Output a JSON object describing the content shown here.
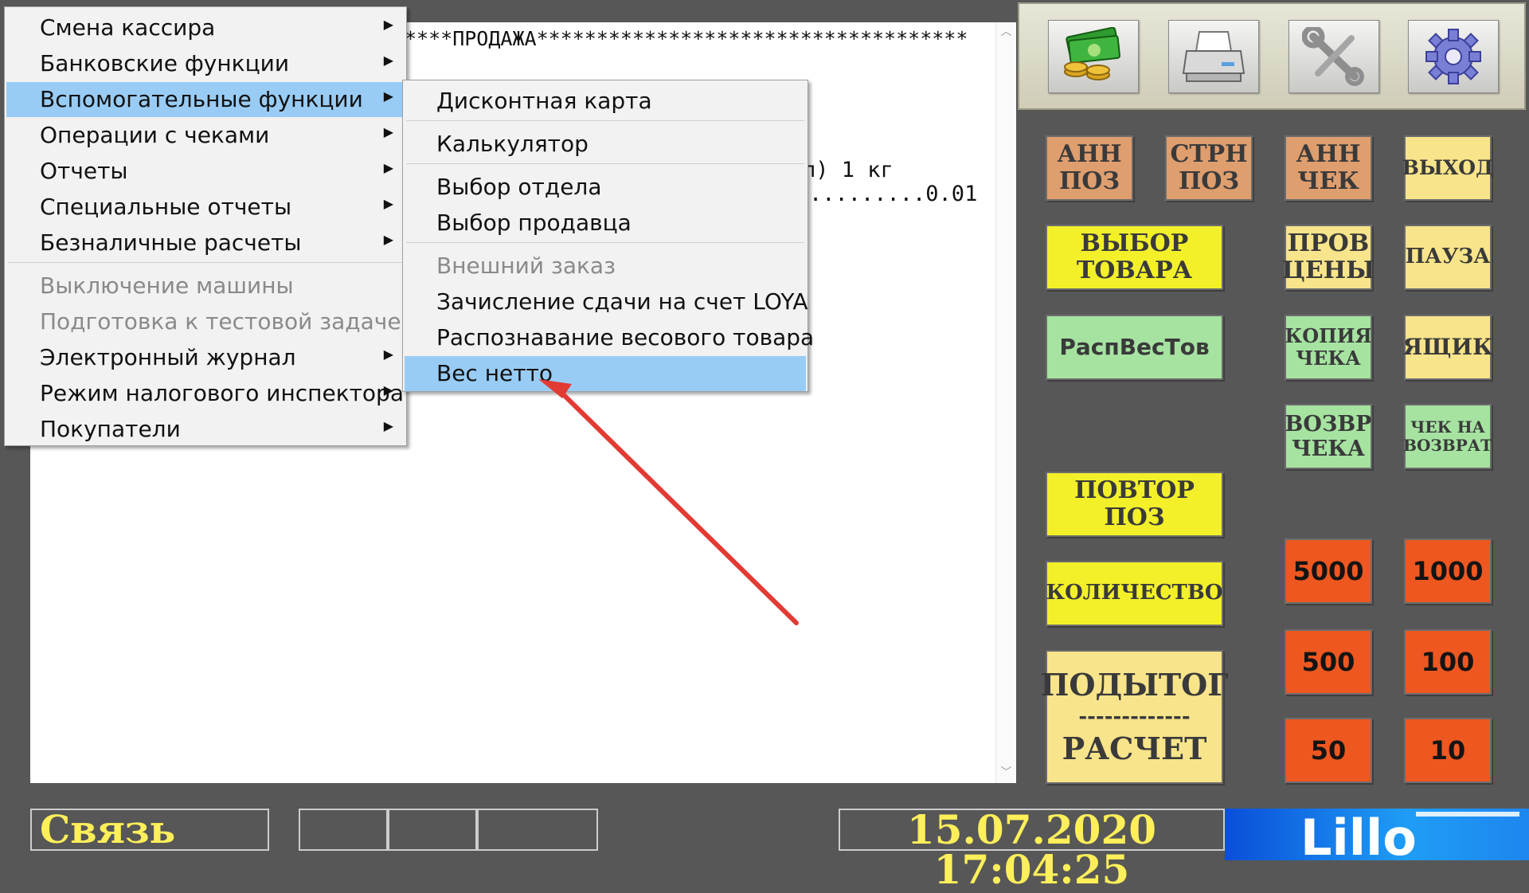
{
  "receipt": {
    "header": "****ПРОДАЖА************************************",
    "line_item": "л) 1 кг",
    "line_price": ".........0.01",
    "scroll_up_icon": "chevron-up-icon",
    "scroll_down_icon": "chevron-down-icon"
  },
  "main_menu": {
    "items": [
      {
        "label": "Смена кассира",
        "submenu": true
      },
      {
        "label": "Банковские функции",
        "submenu": true
      },
      {
        "label": "Вспомогательные функции",
        "submenu": true,
        "highlighted": true
      },
      {
        "label": "Операции с чеками",
        "submenu": true
      },
      {
        "label": "Отчеты",
        "submenu": true
      },
      {
        "label": "Специальные отчеты",
        "submenu": true
      },
      {
        "label": "Безналичные расчеты",
        "submenu": true
      },
      {
        "label": "Выключение машины",
        "disabled": true
      },
      {
        "label": "Подготовка к тестовой задаче",
        "disabled": true
      },
      {
        "label": "Электронный журнал",
        "submenu": true
      },
      {
        "label": "Режим налогового инспектора",
        "submenu": true
      },
      {
        "label": "Покупатели",
        "submenu": true
      }
    ]
  },
  "sub_menu": {
    "items": [
      {
        "label": "Дисконтная карта"
      },
      {
        "label": "Калькулятор"
      },
      {
        "label": "Выбор отдела"
      },
      {
        "label": "Выбор продавца"
      },
      {
        "label": "Внешний заказ",
        "disabled": true
      },
      {
        "label": "Зачисление сдачи на счет LOYA"
      },
      {
        "label": "Распознавание весового товара"
      },
      {
        "label": "Вес нетто",
        "highlighted": true
      }
    ]
  },
  "toolbar": {
    "icons": [
      "money-icon",
      "printer-icon",
      "wrench-icon",
      "gear-icon"
    ]
  },
  "buttons": {
    "ann_pos": "АНН\nПОЗ",
    "strn_pos": "СТРН\nПОЗ",
    "ann_chek": "АНН\nЧЕК",
    "exit": "ВЫХОД",
    "select_item": "ВЫБОР\nТОВАРА",
    "check_price": "ПРОВ\nЦЕНЫ",
    "pause": "ПАУЗА",
    "weight_recog": "РаспВесТов",
    "copy_receipt": "КОПИЯ\nЧЕКА",
    "drawer": "ЯЩИК",
    "return_receipt": "ВОЗВР\nЧЕКА",
    "refund_receipt": "ЧЕК НА\nВОЗВРАТ",
    "repeat_pos": "ПОВТОР\nПОЗ",
    "quantity": "КОЛИЧЕСТВО",
    "subtotal": "ПОДЫТОГ",
    "divider": "-------------",
    "payment": "РАСЧЕТ",
    "n5000": "5000",
    "n1000": "1000",
    "n500": "500",
    "n100": "100",
    "n50": "50",
    "n10": "10"
  },
  "status": {
    "connection": "Связь",
    "datetime": "15.07.2020 17:04:25",
    "logo_text": "Lillo"
  },
  "colors": {
    "background": "#575757",
    "highlight": "#99ccf5",
    "orange": "#df9e6e",
    "yellow": "#f3f02a",
    "light_yellow": "#f8e48a",
    "green": "#a6e3a1",
    "red": "#ee5720",
    "status_text": "#ffef5a",
    "annotation_arrow": "#e23b34"
  }
}
